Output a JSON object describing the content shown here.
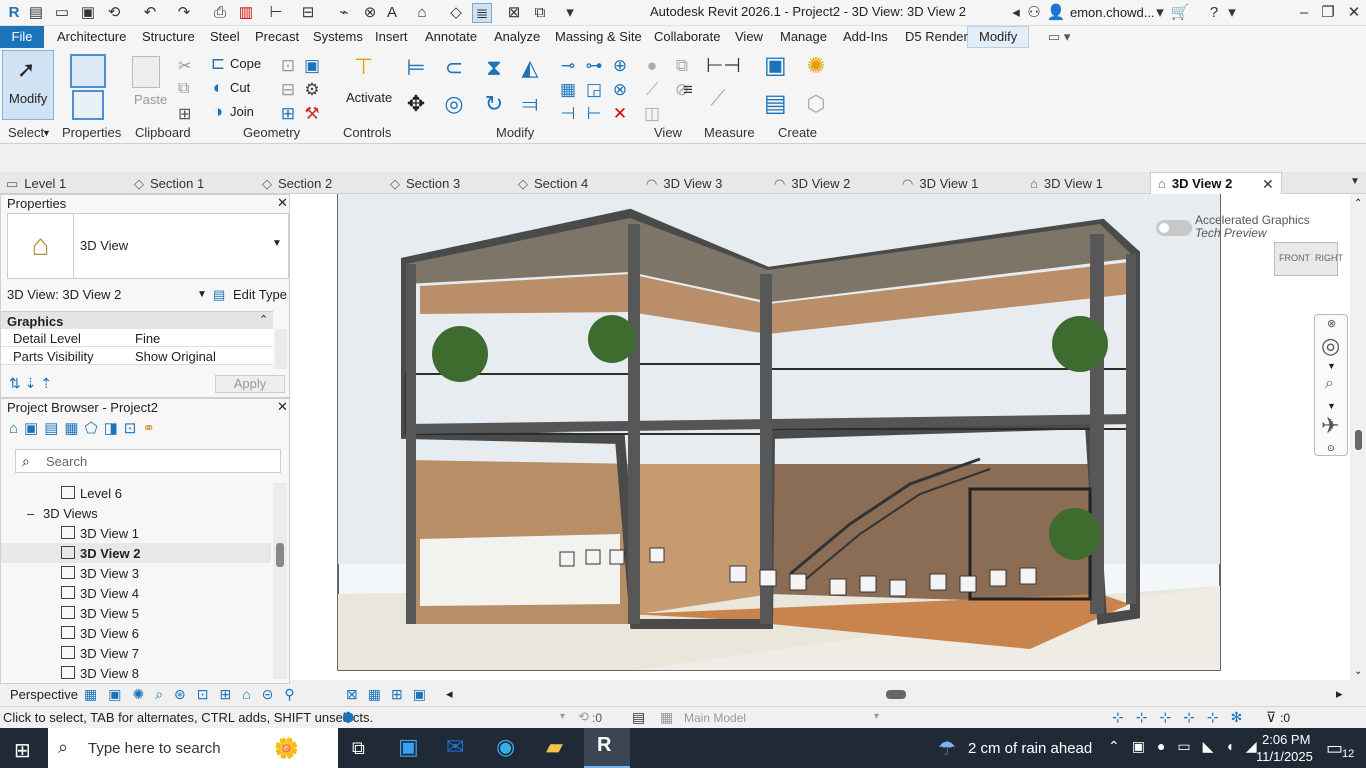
{
  "window": {
    "title": "Autodesk Revit 2026.1 - Project2 - 3D View: 3D View 2",
    "user": "emon.chowd..."
  },
  "menu": {
    "file": "File",
    "items": [
      "Architecture",
      "Structure",
      "Steel",
      "Precast",
      "Systems",
      "Insert",
      "Annotate",
      "Analyze",
      "Massing & Site",
      "Collaborate",
      "View",
      "Manage",
      "Add-Ins",
      "D5 Render",
      "Modify"
    ],
    "active": "Modify"
  },
  "ribbon": {
    "modify_btn": "Modify",
    "select_label": "Select",
    "properties_label": "Properties",
    "paste_label": "Paste",
    "clipboard_label": "Clipboard",
    "cope_label": "Cope",
    "cut_label": "Cut",
    "join_label": "Join",
    "geometry_label": "Geometry",
    "activate_label": "Activate",
    "controls_label": "Controls",
    "modify_panel_label": "Modify",
    "view_label": "View",
    "measure_label": "Measure",
    "create_label": "Create"
  },
  "tabs": [
    "Level 1",
    "Section 1",
    "Section 2",
    "Section 3",
    "Section 4",
    "3D View 3",
    "3D View 2",
    "3D View 1",
    "3D View 1",
    "3D View 2"
  ],
  "properties": {
    "title": "Properties",
    "type_name": "3D View",
    "instance": "3D View: 3D View 2",
    "edit_type": "Edit Type",
    "group": "Graphics",
    "rows": [
      {
        "name": "Detail Level",
        "value": "Fine"
      },
      {
        "name": "Parts Visibility",
        "value": "Show Original"
      }
    ],
    "apply": "Apply"
  },
  "project_browser": {
    "title": "Project Browser - Project2",
    "search_placeholder": "Search",
    "level_item": "Level 6",
    "group": "3D Views",
    "items": [
      "3D View 1",
      "3D View 2",
      "3D View 3",
      "3D View 4",
      "3D View 5",
      "3D View 6",
      "3D View 7",
      "3D View 8"
    ],
    "selected": "3D View 2"
  },
  "viewcube": {
    "front": "FRONT",
    "right": "RIGHT"
  },
  "accelerated_graphics": {
    "line1": "Accelerated Graphics",
    "line2": "Tech Preview"
  },
  "viewbar": {
    "perspective": "Perspective"
  },
  "status": {
    "hint": "Click to select, TAB for alternates, CTRL adds, SHIFT unselects.",
    "sel_count": ":0",
    "model": "Main Model",
    "filter_count": ":0"
  },
  "taskbar": {
    "search_placeholder": "Type here to search",
    "weather": "2 cm of rain ahead",
    "time": "2:06 PM",
    "date": "11/1/2025",
    "notifications": "12"
  },
  "colors": {
    "accent": "#1b73b9",
    "taskbar": "#202a36"
  }
}
